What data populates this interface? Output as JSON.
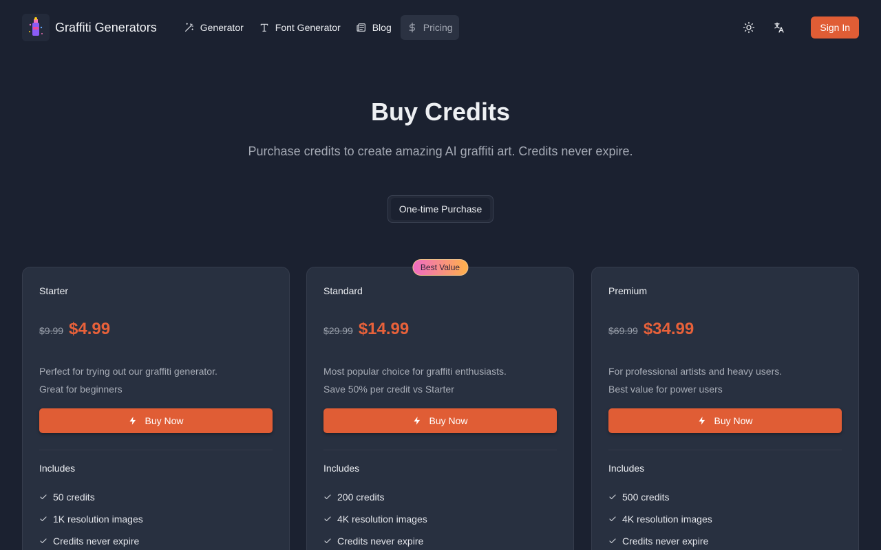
{
  "header": {
    "brand": "Graffiti Generators",
    "nav": [
      {
        "label": "Generator",
        "icon": "magic-wand-icon"
      },
      {
        "label": "Font Generator",
        "icon": "type-icon"
      },
      {
        "label": "Blog",
        "icon": "newspaper-icon"
      },
      {
        "label": "Pricing",
        "icon": "dollar-icon",
        "active": true
      }
    ],
    "sign_in": "Sign In"
  },
  "hero": {
    "title": "Buy Credits",
    "subtitle": "Purchase credits to create amazing AI graffiti art. Credits never expire.",
    "toggle": "One-time Purchase"
  },
  "plans": [
    {
      "name": "Starter",
      "old_price": "$9.99",
      "price": "$4.99",
      "desc1": "Perfect for trying out our graffiti generator.",
      "desc2": "Great for beginners",
      "button": "Buy Now",
      "includes": "Includes",
      "features": [
        "50 credits",
        "1K resolution images",
        "Credits never expire"
      ]
    },
    {
      "name": "Standard",
      "badge": "Best Value",
      "old_price": "$29.99",
      "price": "$14.99",
      "desc1": "Most popular choice for graffiti enthusiasts.",
      "desc2": "Save 50% per credit vs Starter",
      "button": "Buy Now",
      "includes": "Includes",
      "features": [
        "200 credits",
        "4K resolution images",
        "Credits never expire"
      ]
    },
    {
      "name": "Premium",
      "old_price": "$69.99",
      "price": "$34.99",
      "desc1": "For professional artists and heavy users.",
      "desc2": "Best value for power users",
      "button": "Buy Now",
      "includes": "Includes",
      "features": [
        "500 credits",
        "4K resolution images",
        "Credits never expire"
      ]
    }
  ],
  "colors": {
    "accent": "#e05d35",
    "price": "#e8613a",
    "background": "#1b2130",
    "card": "#283040"
  }
}
